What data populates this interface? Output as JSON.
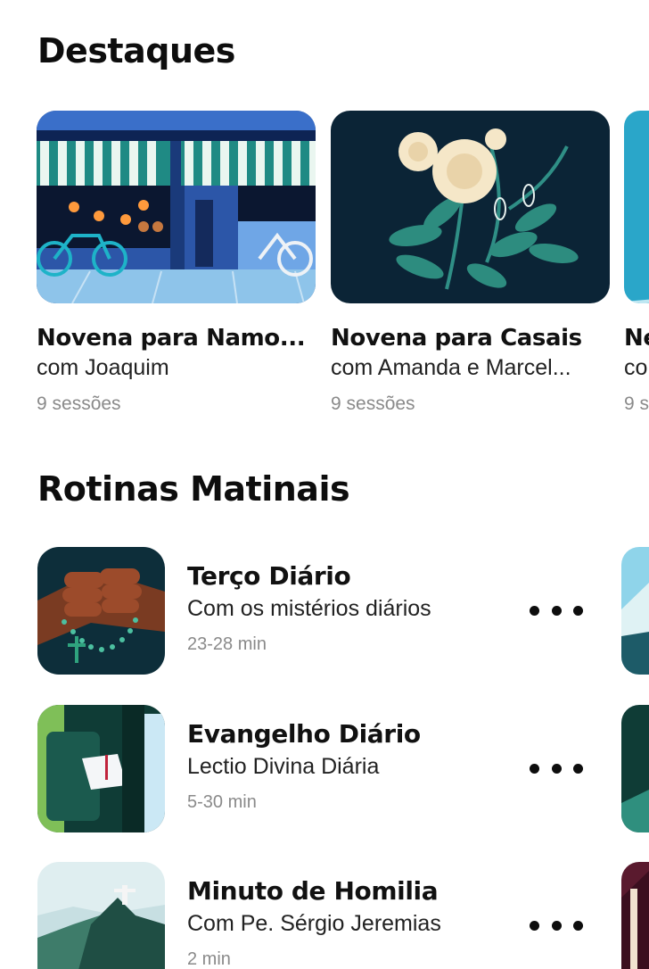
{
  "featured": {
    "title": "Destaques",
    "items": [
      {
        "title": "Novena para Namo...",
        "subtitle": "com Joaquim",
        "sessions": "9 sessões"
      },
      {
        "title": "Novena para Casais",
        "subtitle": "com Amanda e Marcel...",
        "sessions": "9 sessões"
      },
      {
        "title": "Ne",
        "subtitle": "co",
        "sessions": "9 s"
      }
    ]
  },
  "routines": {
    "title": "Rotinas Matinais",
    "items": [
      {
        "title": "Terço Diário",
        "subtitle": "Com os mistérios diários",
        "duration": "23-28 min"
      },
      {
        "title": "Evangelho Diário",
        "subtitle": "Lectio Divina Diária",
        "duration": "5-30 min"
      },
      {
        "title": "Minuto de Homilia",
        "subtitle": "Com Pe. Sérgio Jeremias",
        "duration": "2 min"
      }
    ]
  },
  "icons": {
    "more": "more-horizontal-icon"
  }
}
